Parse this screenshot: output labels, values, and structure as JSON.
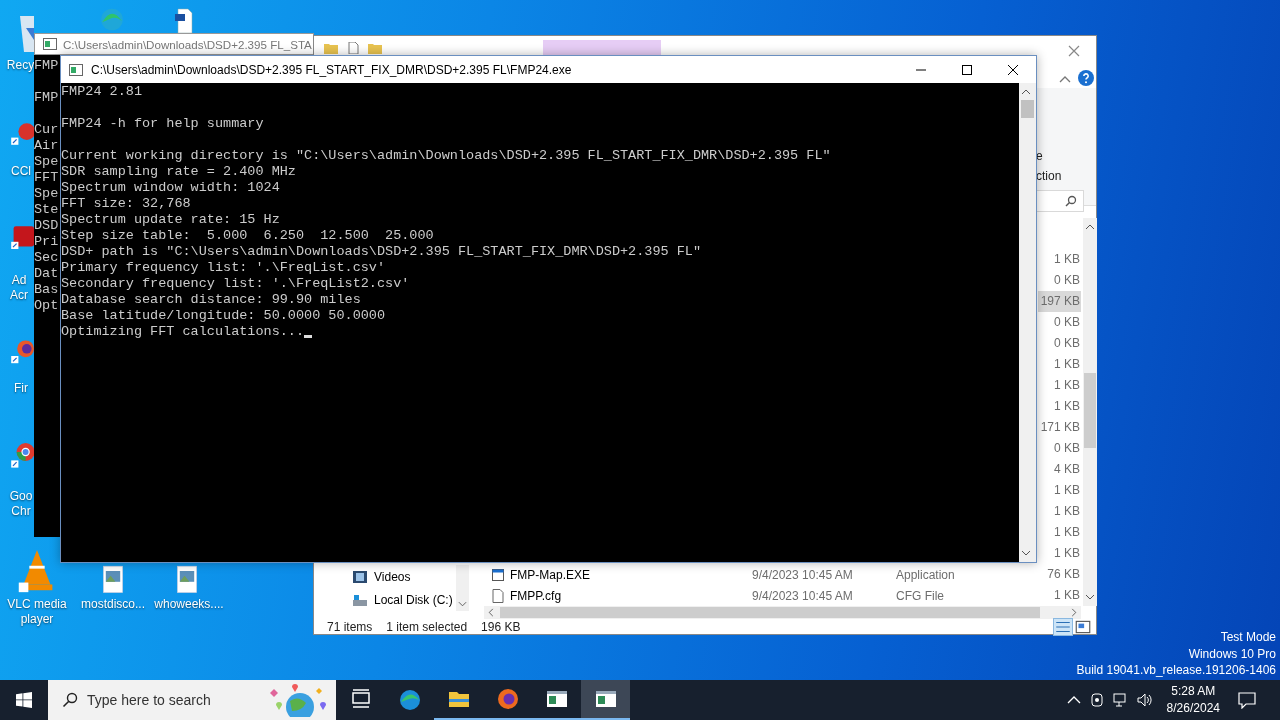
{
  "desktop_icons": [
    {
      "kind": "recycle",
      "label_lines": [
        "Recy"
      ]
    },
    {
      "kind": "edge"
    },
    {
      "kind": "document"
    },
    {
      "kind": "ccleaner",
      "label_lines": [
        "CCl"
      ]
    },
    {
      "kind": "acrobat",
      "label_lines": [
        "Ad",
        "Acr"
      ]
    },
    {
      "kind": "firefox",
      "label_lines": [
        "Fir"
      ]
    },
    {
      "kind": "chrome",
      "label_lines": [
        "Goo",
        "Chr"
      ]
    },
    {
      "kind": "vlc",
      "label_lines": [
        "VLC media",
        "player"
      ]
    },
    {
      "kind": "image",
      "label_lines": [
        "mostdisco..."
      ]
    },
    {
      "kind": "image",
      "label_lines": [
        "whoweeks...."
      ]
    }
  ],
  "back_console": {
    "title": "C:\\Users\\admin\\Downloads\\DSD+2.395 FL_STA",
    "blocks": [
      [
        "FMP"
      ],
      [
        "FMP"
      ],
      [
        "Cur",
        "Air",
        "Spe",
        "FFT",
        "Spe",
        "Ste",
        "DSD",
        "Pri",
        "Sec",
        "Dat",
        "Bas",
        "Opt"
      ]
    ]
  },
  "explorer": {
    "ribbon_fragments": [
      "e",
      "ction"
    ],
    "files": [
      {
        "size": "1 KB",
        "selected": false
      },
      {
        "size": "0 KB",
        "selected": false
      },
      {
        "size": "197 KB",
        "selected": true
      },
      {
        "size": "0 KB",
        "selected": false
      },
      {
        "size": "0 KB",
        "selected": false
      },
      {
        "size": "1 KB",
        "selected": false
      },
      {
        "size": "1 KB",
        "selected": false
      },
      {
        "size": "1 KB",
        "selected": false
      },
      {
        "size": "171 KB",
        "selected": false
      },
      {
        "size": "0 KB",
        "selected": false
      },
      {
        "size": "4 KB",
        "selected": false
      },
      {
        "size": "1 KB",
        "selected": false
      },
      {
        "size": "1 KB",
        "selected": false
      },
      {
        "size": "1 KB",
        "selected": false
      },
      {
        "size": "1 KB",
        "selected": false
      },
      {
        "name": "FMP-Map.EXE",
        "kind": "exe",
        "date": "9/4/2023 10:45 AM",
        "type": "Application",
        "size": "76 KB",
        "selected": false
      },
      {
        "name": "FMPP.cfg",
        "kind": "file",
        "date": "9/4/2023 10:45 AM",
        "type": "CFG File",
        "size": "1 KB",
        "selected": false
      }
    ],
    "nav_items": [
      {
        "label": "Videos",
        "kind": "videos"
      },
      {
        "label": "Local Disk (C:)",
        "kind": "disk"
      }
    ],
    "status": {
      "items": "71 items",
      "selected": "1 item selected",
      "size": "196 KB"
    }
  },
  "console": {
    "title": "C:\\Users\\admin\\Downloads\\DSD+2.395 FL_START_FIX_DMR\\DSD+2.395 FL\\FMP24.exe",
    "blocks": [
      [
        "FMP24 2.81"
      ],
      [
        "FMP24 -h for help summary"
      ],
      [
        "Current working directory is \"C:\\Users\\admin\\Downloads\\DSD+2.395 FL_START_FIX_DMR\\DSD+2.395 FL\"",
        "SDR sampling rate = 2.400 MHz",
        "Spectrum window width: 1024",
        "FFT size: 32,768",
        "Spectrum update rate: 15 Hz",
        "Step size table:  5.000  6.250  12.500  25.000",
        "DSD+ path is \"C:\\Users\\admin\\Downloads\\DSD+2.395 FL_START_FIX_DMR\\DSD+2.395 FL\"",
        "Primary frequency list: '.\\FreqList.csv'",
        "Secondary frequency list: '.\\FreqList2.csv'",
        "Database search distance: 99.90 miles",
        "Base latitude/longitude: 50.0000 50.0000",
        "Optimizing FFT calculations..."
      ]
    ]
  },
  "os_watermark": [
    "Test Mode",
    "Windows 10 Pro",
    "Build 19041.vb_release.191206-1406"
  ],
  "taskbar": {
    "search_placeholder": "Type here to search",
    "apps": [
      {
        "kind": "taskview",
        "selected": false,
        "running": false
      },
      {
        "kind": "edge",
        "selected": false,
        "running": false
      },
      {
        "kind": "explorer",
        "selected": false,
        "running": true
      },
      {
        "kind": "firefox",
        "selected": false,
        "running": true
      },
      {
        "kind": "console",
        "selected": false,
        "running": true
      },
      {
        "kind": "console",
        "selected": true,
        "running": true
      }
    ],
    "time": "5:28 AM",
    "date": "8/26/2024"
  }
}
